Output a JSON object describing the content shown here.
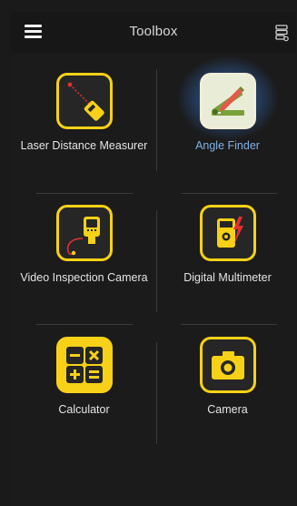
{
  "header": {
    "title": "Toolbox",
    "menu_icon": "hamburger-menu-icon",
    "settings_icon": "storage-settings-icon"
  },
  "tools": [
    {
      "label": "Laser Distance Measurer",
      "icon": "laser-measure-icon",
      "active": false
    },
    {
      "label": "Angle Finder",
      "icon": "angle-finder-icon",
      "active": true
    },
    {
      "label": "Video Inspection Camera",
      "icon": "inspection-camera-icon",
      "active": false
    },
    {
      "label": "Digital Multimeter",
      "icon": "multimeter-icon",
      "active": false
    },
    {
      "label": "Calculator",
      "icon": "calculator-icon",
      "active": false
    },
    {
      "label": "Camera",
      "icon": "camera-icon",
      "active": false
    }
  ],
  "colors": {
    "accent": "#f7d117",
    "active_label": "#7fb2e6",
    "background": "#1b1b1b"
  }
}
